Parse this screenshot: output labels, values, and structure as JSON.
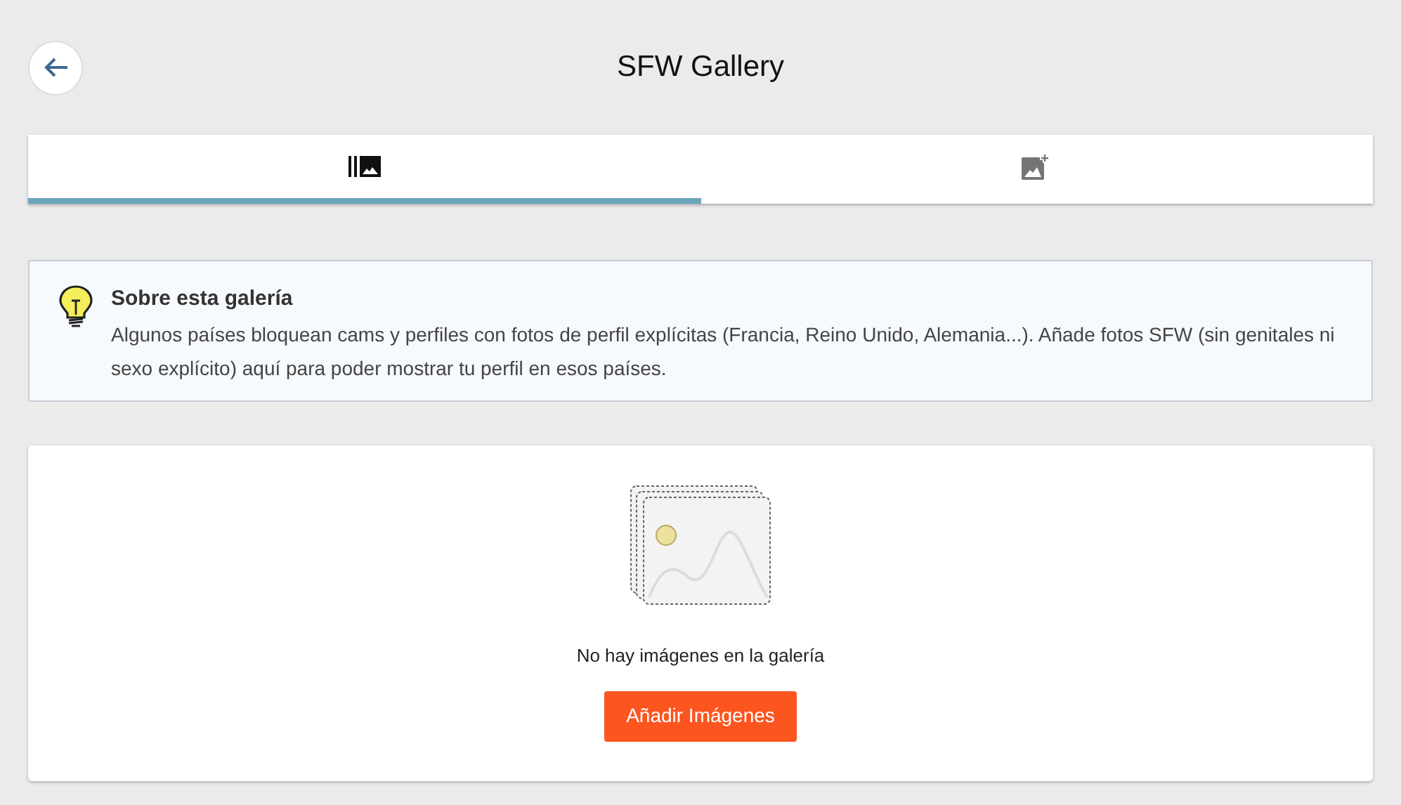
{
  "header": {
    "title": "SFW Gallery"
  },
  "tabs": [
    {
      "kind": "library",
      "selected": true
    },
    {
      "kind": "add-photo",
      "selected": false
    }
  ],
  "info": {
    "title": "Sobre esta galería",
    "text": "Algunos países bloquean cams y perfiles con fotos de perfil explícitas (Francia, Reino Unido, Alemania...). Añade fotos SFW (sin genitales ni sexo explícito) aquí para poder mostrar tu perfil en esos países."
  },
  "empty": {
    "message": "No hay imágenes en la galería",
    "button": "Añadir Imágenes"
  }
}
